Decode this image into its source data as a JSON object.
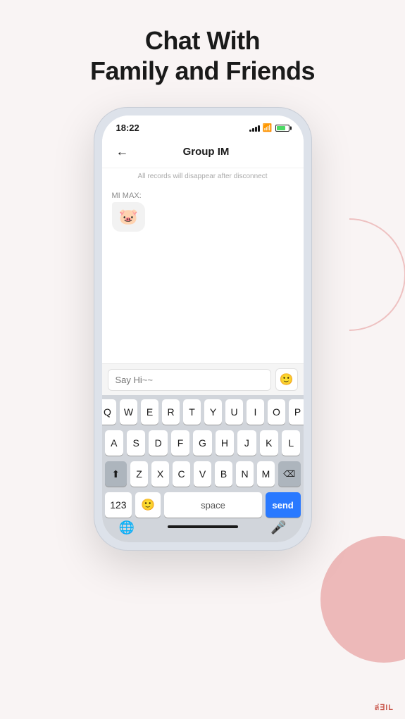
{
  "page": {
    "title_line1": "Chat With",
    "title_line2": "Family and Friends"
  },
  "status_bar": {
    "time": "18:22",
    "battery_color": "#4cd964"
  },
  "header": {
    "title": "Group IM",
    "back_label": "←"
  },
  "chat": {
    "info_text": "All records will disappear after disconnect",
    "messages": [
      {
        "sender": "MI MAX:",
        "content": "🐷"
      }
    ]
  },
  "input": {
    "placeholder": "Say Hi~~",
    "emoji_icon": "🙂"
  },
  "keyboard": {
    "row1": [
      "Q",
      "W",
      "E",
      "R",
      "T",
      "Y",
      "U",
      "I",
      "O",
      "P"
    ],
    "row2": [
      "A",
      "S",
      "D",
      "F",
      "G",
      "H",
      "J",
      "K",
      "L"
    ],
    "row3": [
      "Z",
      "X",
      "C",
      "V",
      "B",
      "N",
      "M"
    ],
    "num_label": "123",
    "space_label": "space",
    "send_label": "send"
  },
  "watermark": "ล่∃IL"
}
